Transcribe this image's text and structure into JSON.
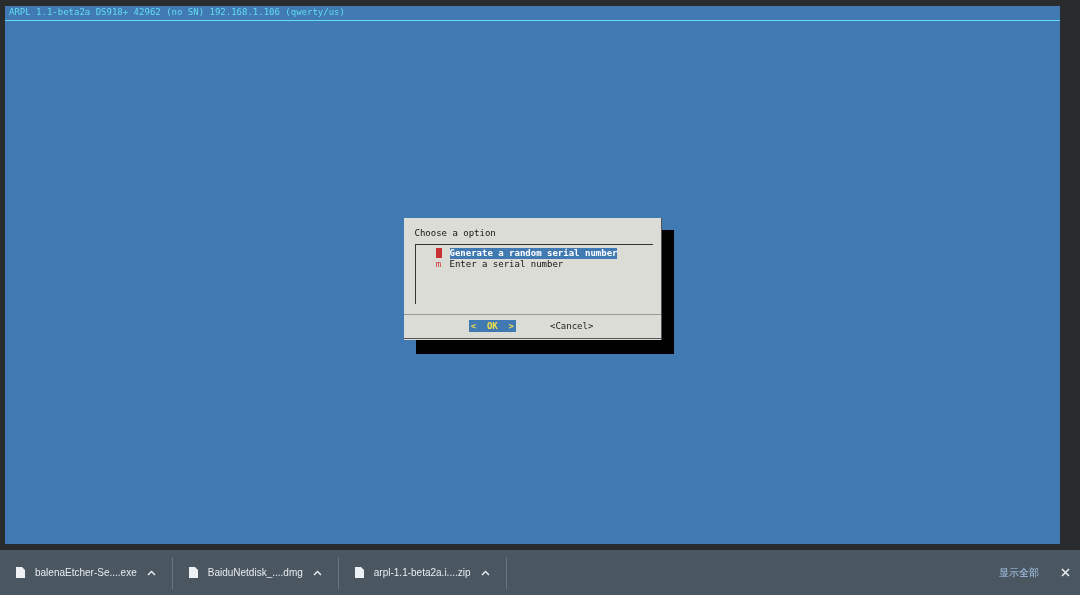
{
  "terminal": {
    "header": "ARPL 1.1-beta2a DS918+ 42962 (no SN) 192.168.1.106 (qwerty/us)"
  },
  "dialog": {
    "title": "Choose a option",
    "items": [
      {
        "label": "Generate a random serial number",
        "selected": true
      },
      {
        "tag": "m",
        "label": "Enter a serial number",
        "selected": false
      }
    ],
    "buttons": [
      {
        "label": "<  OK  >",
        "selected": true
      },
      {
        "label": "<Cancel>",
        "selected": false
      }
    ]
  },
  "downloads": {
    "items": [
      {
        "name": "balenaEtcher-Se....exe"
      },
      {
        "name": "BaiduNetdisk_....dmg"
      },
      {
        "name": "arpl-1.1-beta2a.i....zip"
      }
    ],
    "show_all": "显示全部"
  }
}
